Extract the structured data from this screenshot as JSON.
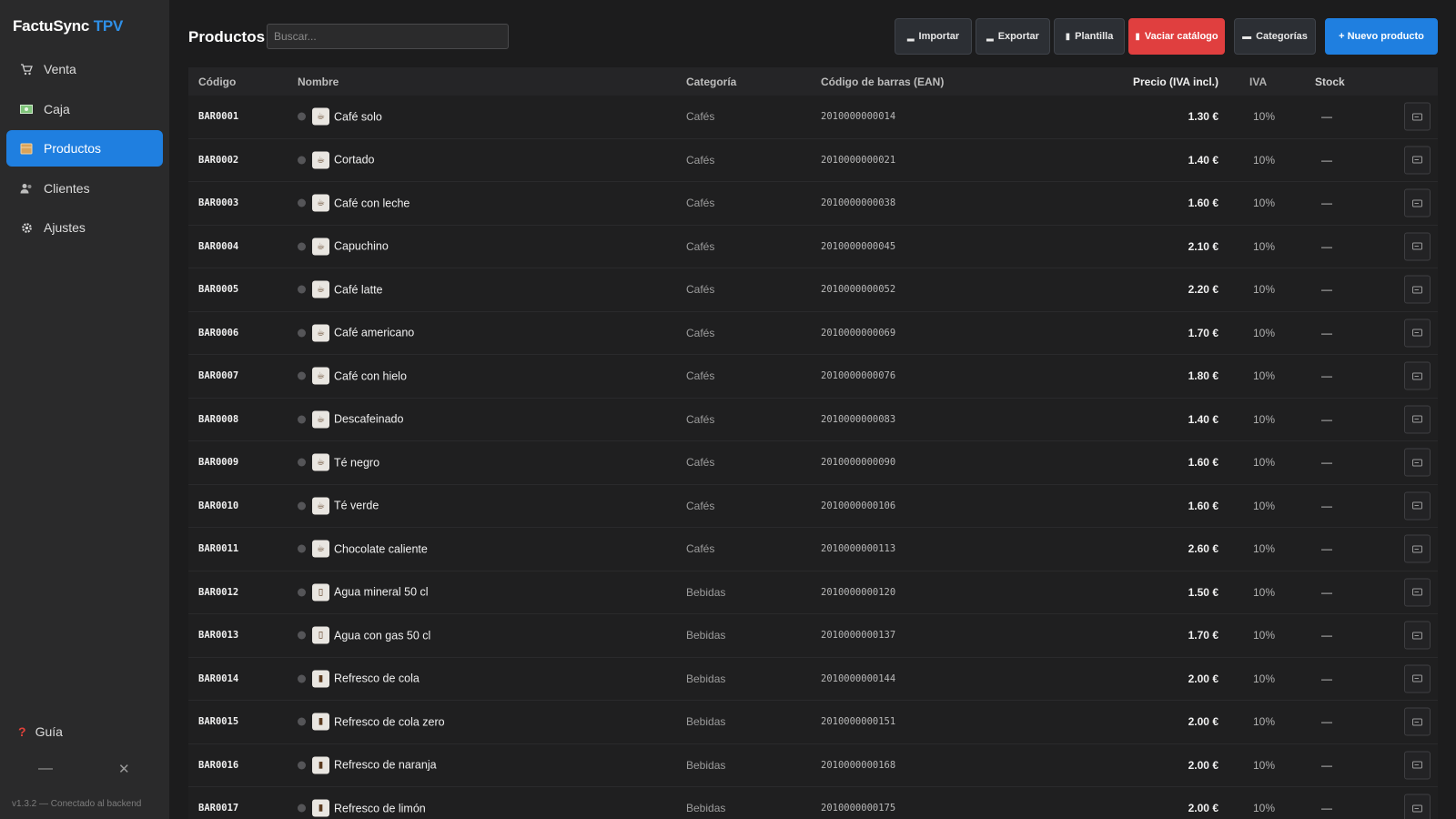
{
  "app": {
    "name": "FactuSync",
    "name_accent": "TPV",
    "version": "v1.3.2 — Conectado al backend"
  },
  "sidebar": {
    "items": [
      {
        "label": "Venta",
        "icon": "cart-icon"
      },
      {
        "label": "Caja",
        "icon": "cash-icon"
      },
      {
        "label": "Productos",
        "icon": "box-icon",
        "active": true
      },
      {
        "label": "Clientes",
        "icon": "users-icon"
      },
      {
        "label": "Ajustes",
        "icon": "gear-icon"
      }
    ],
    "guide": "Guía",
    "minimize": "—",
    "close": "✕"
  },
  "header": {
    "title": "Productos",
    "search_placeholder": "Buscar...",
    "buttons": {
      "import": "Importar",
      "export": "Exportar",
      "template": "Plantilla",
      "clear": "Vaciar catálogo",
      "categories": "Categorías",
      "new": "+ Nuevo producto"
    }
  },
  "table": {
    "headers": {
      "code": "Código",
      "name": "Nombre",
      "category": "Categoría",
      "ean": "Código de barras (EAN)",
      "price": "Precio (IVA incl.)",
      "iva": "IVA",
      "stock": "Stock"
    },
    "rows": [
      {
        "code": "BAR0001",
        "name": "Café solo",
        "category": "Cafés",
        "ean": "2010000000014",
        "price": "1.30 €",
        "iva": "10%",
        "stock": "—",
        "img": "☕"
      },
      {
        "code": "BAR0002",
        "name": "Cortado",
        "category": "Cafés",
        "ean": "2010000000021",
        "price": "1.40 €",
        "iva": "10%",
        "stock": "—",
        "img": "☕"
      },
      {
        "code": "BAR0003",
        "name": "Café con leche",
        "category": "Cafés",
        "ean": "2010000000038",
        "price": "1.60 €",
        "iva": "10%",
        "stock": "—",
        "img": "☕"
      },
      {
        "code": "BAR0004",
        "name": "Capuchino",
        "category": "Cafés",
        "ean": "2010000000045",
        "price": "2.10 €",
        "iva": "10%",
        "stock": "—",
        "img": "☕"
      },
      {
        "code": "BAR0005",
        "name": "Café latte",
        "category": "Cafés",
        "ean": "2010000000052",
        "price": "2.20 €",
        "iva": "10%",
        "stock": "—",
        "img": "☕"
      },
      {
        "code": "BAR0006",
        "name": "Café americano",
        "category": "Cafés",
        "ean": "2010000000069",
        "price": "1.70 €",
        "iva": "10%",
        "stock": "—",
        "img": "☕"
      },
      {
        "code": "BAR0007",
        "name": "Café con hielo",
        "category": "Cafés",
        "ean": "2010000000076",
        "price": "1.80 €",
        "iva": "10%",
        "stock": "—",
        "img": "☕"
      },
      {
        "code": "BAR0008",
        "name": "Descafeinado",
        "category": "Cafés",
        "ean": "2010000000083",
        "price": "1.40 €",
        "iva": "10%",
        "stock": "—",
        "img": "☕"
      },
      {
        "code": "BAR0009",
        "name": "Té negro",
        "category": "Cafés",
        "ean": "2010000000090",
        "price": "1.60 €",
        "iva": "10%",
        "stock": "—",
        "img": "☕"
      },
      {
        "code": "BAR0010",
        "name": "Té verde",
        "category": "Cafés",
        "ean": "2010000000106",
        "price": "1.60 €",
        "iva": "10%",
        "stock": "—",
        "img": "☕"
      },
      {
        "code": "BAR0011",
        "name": "Chocolate caliente",
        "category": "Cafés",
        "ean": "2010000000113",
        "price": "2.60 €",
        "iva": "10%",
        "stock": "—",
        "img": "☕"
      },
      {
        "code": "BAR0012",
        "name": "Agua mineral 50 cl",
        "category": "Bebidas",
        "ean": "2010000000120",
        "price": "1.50 €",
        "iva": "10%",
        "stock": "—",
        "img": "▯"
      },
      {
        "code": "BAR0013",
        "name": "Agua con gas 50 cl",
        "category": "Bebidas",
        "ean": "2010000000137",
        "price": "1.70 €",
        "iva": "10%",
        "stock": "—",
        "img": "▯"
      },
      {
        "code": "BAR0014",
        "name": "Refresco de cola",
        "category": "Bebidas",
        "ean": "2010000000144",
        "price": "2.00 €",
        "iva": "10%",
        "stock": "—",
        "img": "▮"
      },
      {
        "code": "BAR0015",
        "name": "Refresco de cola zero",
        "category": "Bebidas",
        "ean": "2010000000151",
        "price": "2.00 €",
        "iva": "10%",
        "stock": "—",
        "img": "▮"
      },
      {
        "code": "BAR0016",
        "name": "Refresco de naranja",
        "category": "Bebidas",
        "ean": "2010000000168",
        "price": "2.00 €",
        "iva": "10%",
        "stock": "—",
        "img": "▮"
      },
      {
        "code": "BAR0017",
        "name": "Refresco de limón",
        "category": "Bebidas",
        "ean": "2010000000175",
        "price": "2.00 €",
        "iva": "10%",
        "stock": "—",
        "img": "▮"
      }
    ]
  },
  "colors": {
    "accent": "#1f7fe0",
    "danger": "#e03f3f",
    "sidebar": "#2a2a2b",
    "background": "#1c1c1d"
  }
}
